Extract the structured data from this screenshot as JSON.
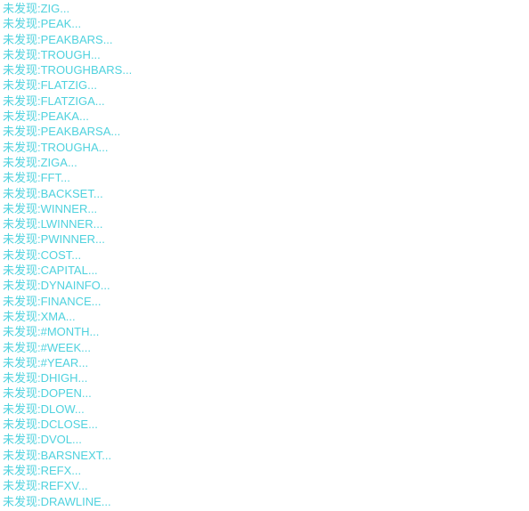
{
  "window": {
    "title": "Log Output",
    "background_color": "#ffffff"
  },
  "log": {
    "text_color": "#4fd2de",
    "prefix": "未发现:",
    "suffix": "...",
    "line_count": 33,
    "lines": [
      "未发现:ZIG...",
      "未发现:PEAK...",
      "未发现:PEAKBARS...",
      "未发现:TROUGH...",
      "未发现:TROUGHBARS...",
      "未发现:FLATZIG...",
      "未发现:FLATZIGA...",
      "未发现:PEAKA...",
      "未发现:PEAKBARSA...",
      "未发现:TROUGHA...",
      "未发现:ZIGA...",
      "未发现:FFT...",
      "未发现:BACKSET...",
      "未发现:WINNER...",
      "未发现:LWINNER...",
      "未发现:PWINNER...",
      "未发现:COST...",
      "未发现:CAPITAL...",
      "未发现:DYNAINFO...",
      "未发现:FINANCE...",
      "未发现:XMA...",
      "未发现:#MONTH...",
      "未发现:#WEEK...",
      "未发现:#YEAR...",
      "未发现:DHIGH...",
      "未发现:DOPEN...",
      "未发现:DLOW...",
      "未发现:DCLOSE...",
      "未发现:DVOL...",
      "未发现:BARSNEXT...",
      "未发现:REFX...",
      "未发现:REFXV...",
      "未发现:DRAWLINE..."
    ]
  }
}
